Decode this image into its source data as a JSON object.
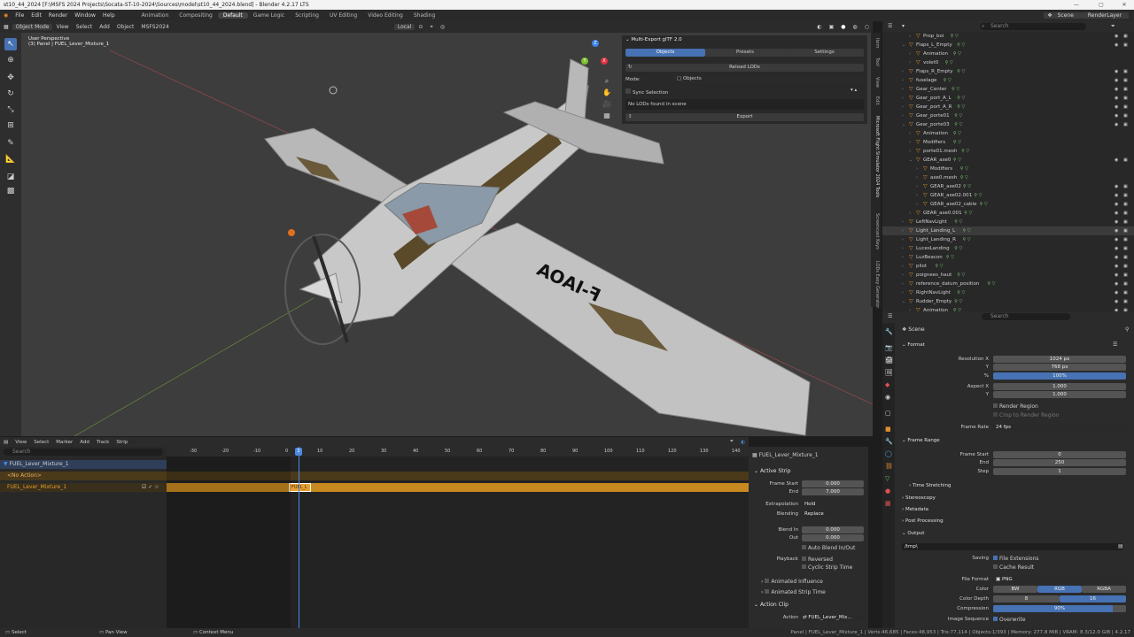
{
  "window": {
    "title": "st10_44_2024 [F:\\MSFS 2024 Projects\\Socata-ST-10-2024\\Sources\\model\\st10_44_2024.blend] - Blender 4.2.17 LTS",
    "min": "—",
    "max": "▢",
    "close": "✕"
  },
  "menubar": {
    "items": [
      "File",
      "Edit",
      "Render",
      "Window",
      "Help"
    ],
    "workspaces": [
      "Animation",
      "Compositing",
      "Default",
      "Game Logic",
      "Scripting",
      "UV Editing",
      "Video Editing",
      "Shading"
    ],
    "active_workspace": "Default",
    "scene": "Scene",
    "view_layer": "RenderLayer"
  },
  "viewport": {
    "mode": "Object Mode",
    "menu": [
      "View",
      "Select",
      "Add",
      "Object",
      "MSFS2024"
    ],
    "orientation": "Local",
    "info_line1": "User Perspective",
    "info_line2": "(3) Panel | FUEL_Lever_Mixture_1",
    "registration": "F-IAOA"
  },
  "gizmo": {
    "x": "X",
    "y": "Y",
    "z": "Z",
    "colors": {
      "x": "#e0313f",
      "y": "#7bbf2e",
      "z": "#3a84e8"
    }
  },
  "tool_icons": [
    "cursor-icon",
    "move-icon",
    "rotate-icon",
    "scale-icon",
    "transform-icon",
    "annotate-icon",
    "measure-icon",
    "add-cube-icon",
    "extra-tool-icon"
  ],
  "npanel": {
    "title": "Multi-Export glTF 2.0",
    "tabs": [
      "Objects",
      "Presets",
      "Settings"
    ],
    "active_tab": "Objects",
    "reload": "Reload LODs",
    "mode_label": "Mode:",
    "mode_value": "Objects",
    "sync": "Sync Selection",
    "empty_msg": "No LODs found in scene",
    "export": "Export"
  },
  "side_tabs": [
    "Item",
    "Tool",
    "View",
    "Edit",
    "Microsoft Flight Simulator 2024 Tools",
    "Screencast Keys",
    "LODs Easy Generator"
  ],
  "outliner": {
    "search_placeholder": "Search",
    "rows": [
      {
        "name": "Prop_boi",
        "d": 1,
        "tri": "›"
      },
      {
        "name": "Flaps_L_Empty",
        "d": 0,
        "tri": "⌄"
      },
      {
        "name": "Animation",
        "d": 1,
        "tri": "›"
      },
      {
        "name": "volet0",
        "d": 1,
        "tri": "›"
      },
      {
        "name": "Flaps_R_Empty",
        "d": 0,
        "tri": "›"
      },
      {
        "name": "fuselage",
        "d": 0,
        "tri": "›"
      },
      {
        "name": "Gear_Center",
        "d": 0,
        "tri": "›"
      },
      {
        "name": "Gear_port_A_L",
        "d": 0,
        "tri": "›"
      },
      {
        "name": "Gear_port_A_R",
        "d": 0,
        "tri": "›"
      },
      {
        "name": "Gear_porte01",
        "d": 0,
        "tri": "›"
      },
      {
        "name": "Gear_porte03",
        "d": 0,
        "tri": "⌄"
      },
      {
        "name": "Animation",
        "d": 1,
        "tri": "›"
      },
      {
        "name": "Modifiers",
        "d": 1,
        "tri": "›"
      },
      {
        "name": "porte01.mesh",
        "d": 1,
        "tri": "›"
      },
      {
        "name": "GEAR_axe0",
        "d": 1,
        "tri": "⌄"
      },
      {
        "name": "Modifiers",
        "d": 2,
        "tri": "›"
      },
      {
        "name": "axe0.mesh",
        "d": 2,
        "tri": "›"
      },
      {
        "name": "GEAR_axe02",
        "d": 2,
        "tri": "›"
      },
      {
        "name": "GEAR_axe02.001",
        "d": 2,
        "tri": "›"
      },
      {
        "name": "GEAR_axe02_cable",
        "d": 2,
        "tri": "›"
      },
      {
        "name": "GEAR_axe0.001",
        "d": 1,
        "tri": "›"
      },
      {
        "name": "LeftNavLight",
        "d": 0,
        "tri": "›"
      },
      {
        "name": "Light_Landing_L",
        "d": 0,
        "tri": "›"
      },
      {
        "name": "Light_Landing_R",
        "d": 0,
        "tri": "›"
      },
      {
        "name": "LucesLanding",
        "d": 0,
        "tri": "›"
      },
      {
        "name": "LuzBeacon",
        "d": 0,
        "tri": "›"
      },
      {
        "name": "pilot",
        "d": 0,
        "tri": "›"
      },
      {
        "name": "poignees_haut",
        "d": 0,
        "tri": "›"
      },
      {
        "name": "reference_datum_position",
        "d": 0,
        "tri": "›"
      },
      {
        "name": "RightNavLight",
        "d": 0,
        "tri": "›"
      },
      {
        "name": "Rudder_Empty",
        "d": 0,
        "tri": "⌄"
      },
      {
        "name": "Animation",
        "d": 1,
        "tri": "›"
      }
    ]
  },
  "properties": {
    "search_placeholder": "Search",
    "context": "Scene",
    "format": {
      "header": "Format",
      "res_x_label": "Resolution X",
      "res_x": "1024 px",
      "res_y_label": "Y",
      "res_y": "768 px",
      "pct_label": "%",
      "pct": "100%",
      "aspect_x_label": "Aspect X",
      "aspect_x": "1.000",
      "aspect_y_label": "Y",
      "aspect_y": "1.000",
      "render_region": "Render Region",
      "crop": "Crop to Render Region",
      "frame_rate_label": "Frame Rate",
      "frame_rate": "24 fps"
    },
    "frame_range": {
      "header": "Frame Range",
      "start_label": "Frame Start",
      "start": "0",
      "end_label": "End",
      "end": "250",
      "step_label": "Step",
      "step": "1",
      "time_stretching": "Time Stretching"
    },
    "sections": [
      "Stereoscopy",
      "Metadata",
      "Post Processing"
    ],
    "output": {
      "header": "Output",
      "path": "/tmp\\",
      "saving_label": "Saving",
      "file_ext": "File Extensions",
      "cache": "Cache Result",
      "file_format_label": "File Format",
      "file_format": "PNG",
      "color_label": "Color",
      "color_opts": [
        "BW",
        "RGB",
        "RGBA"
      ],
      "color_active": "RGB",
      "depth_label": "Color Depth",
      "depth_opts": [
        "8",
        "16"
      ],
      "depth_active": "16",
      "compression_label": "Compression",
      "compression": "90%",
      "image_seq_label": "Image Sequence",
      "overwrite": "Overwrite"
    }
  },
  "timeline": {
    "menu": [
      "View",
      "Select",
      "Marker",
      "Add",
      "Track",
      "Strip"
    ],
    "search_placeholder": "Search",
    "ticks": [
      "-30",
      "-20",
      "-10",
      "0",
      "10",
      "20",
      "30",
      "40",
      "50",
      "60",
      "70",
      "80",
      "90",
      "100",
      "110",
      "120",
      "130",
      "140"
    ],
    "current_frame": "3",
    "track_name": "FUEL_Lever_Mixture_1",
    "no_action": "<No Action>",
    "track2": "FUEL_Lever_Mixture_1",
    "strip_label": "FUEL_L"
  },
  "strip_panel": {
    "title": "FUEL_Lever_Mixture_1",
    "active_strip": "Active Strip",
    "frame_start_label": "Frame Start",
    "frame_start": "0.000",
    "end_label": "End",
    "end": "7.000",
    "extrapolation_label": "Extrapolation",
    "extrapolation": "Hold",
    "blending_label": "Blending",
    "blending": "Replace",
    "blend_in_label": "Blend In",
    "blend_in": "0.000",
    "blend_out_label": "Out",
    "blend_out": "0.000",
    "auto_blend": "Auto Blend In/Out",
    "playback_label": "Playback",
    "reversed": "Reversed",
    "cyclic": "Cyclic Strip Time",
    "anim_influence": "Animated Influence",
    "anim_strip_time": "Animated Strip Time",
    "action_clip": "Action Clip",
    "action_label": "Action",
    "action_value": "FUEL_Lever_Mix..."
  },
  "statusbar": {
    "select": "Select",
    "pan": "Pan View",
    "context": "Context Menu",
    "stats": "Panel | FUEL_Lever_Mixture_1 | Verts:46,685 | Faces:48,953 | Tris:77,114 | Objects:1/393 | Memory: 277.8 MiB | VRAM: 8.3/12.0 GiB | 4.2.17"
  },
  "colors": {
    "accent": "#4772b3",
    "object_orange": "#e0902e",
    "strip_orange": "#e0a030"
  }
}
